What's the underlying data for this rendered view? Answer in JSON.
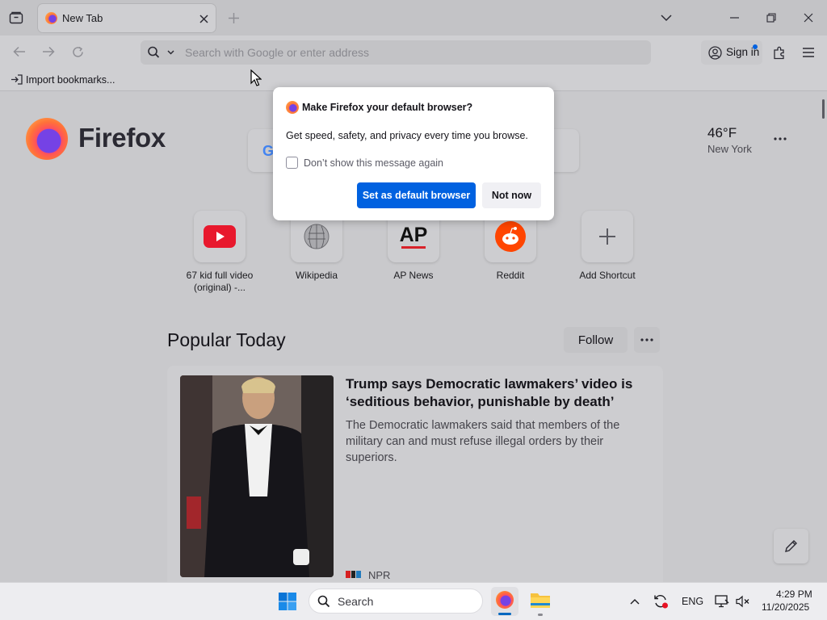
{
  "tab": {
    "title": "New Tab"
  },
  "urlbar": {
    "placeholder": "Search with Google or enter address"
  },
  "toolbar": {
    "sign_in_label": "Sign in"
  },
  "bookmarks": {
    "import_label": "Import bookmarks..."
  },
  "brand": {
    "wordmark": "Firefox"
  },
  "weather": {
    "temp": "46°F",
    "location": "New York"
  },
  "shortcuts": [
    {
      "label": "67 kid full video (original) -...",
      "icon": "youtube-icon"
    },
    {
      "label": "Wikipedia",
      "icon": "wikipedia-icon"
    },
    {
      "label": "AP News",
      "icon": "ap-news-icon"
    },
    {
      "label": "Reddit",
      "icon": "reddit-icon"
    },
    {
      "label": "Add Shortcut",
      "icon": "plus-icon"
    }
  ],
  "popular": {
    "heading": "Popular Today",
    "follow_label": "Follow"
  },
  "story": {
    "headline": "Trump says Democratic lawmakers’ video is ‘seditious behavior, punishable by death’",
    "excerpt": "The Democratic lawmakers said that members of the military can and must refuse illegal orders by their superiors.",
    "source": "NPR"
  },
  "dialog": {
    "title": "Make Firefox your default browser?",
    "body": "Get speed, safety, and privacy every time you browse.",
    "checkbox_label": "Don’t show this message again",
    "primary_label": "Set as default browser",
    "secondary_label": "Not now"
  },
  "taskbar": {
    "search_placeholder": "Search",
    "lang": "ENG",
    "time": "4:29 PM",
    "date": "11/20/2025"
  },
  "colors": {
    "accent": "#0061e0",
    "firefox_orange": "#ff7139",
    "firefox_purple": "#7542e5"
  }
}
